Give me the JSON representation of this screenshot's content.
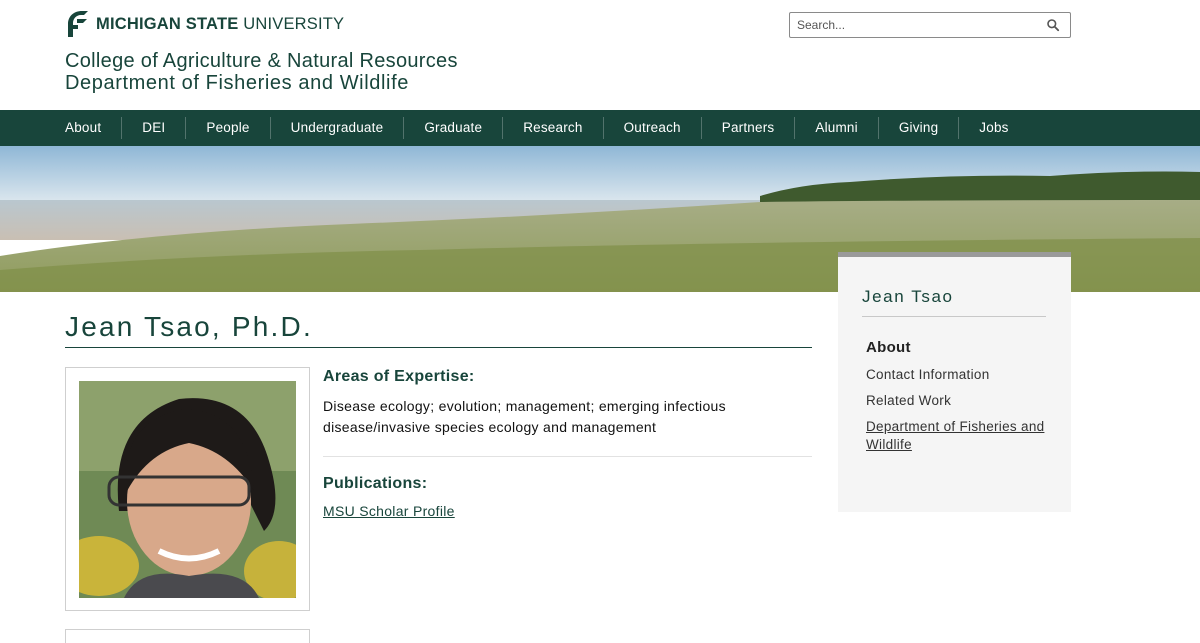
{
  "header": {
    "university_bold": "MICHIGAN STATE",
    "university_light": "UNIVERSITY",
    "college": "College of Agriculture & Natural Resources",
    "department": "Department of Fisheries and Wildlife"
  },
  "search": {
    "placeholder": "Search...",
    "icon": "magnifier-icon"
  },
  "nav": {
    "items": [
      "About",
      "DEI",
      "People",
      "Undergraduate",
      "Graduate",
      "Research",
      "Outreach",
      "Partners",
      "Alumni",
      "Giving",
      "Jobs"
    ]
  },
  "profile": {
    "name": "Jean Tsao, Ph.D.",
    "expertise_heading": "Areas of Expertise:",
    "expertise_text": "Disease ecology; evolution; management; emerging infectious disease/invasive species ecology and management",
    "publications_heading": "Publications:",
    "publications_link": "MSU Scholar Profile"
  },
  "sidebar": {
    "title": "Jean Tsao",
    "items": [
      "About",
      "Contact Information",
      "Related Work",
      "Department of Fisheries and Wildlife"
    ],
    "active": "About"
  },
  "colors": {
    "brand_green": "#18453b",
    "sidebar_bg": "#f5f5f5"
  }
}
